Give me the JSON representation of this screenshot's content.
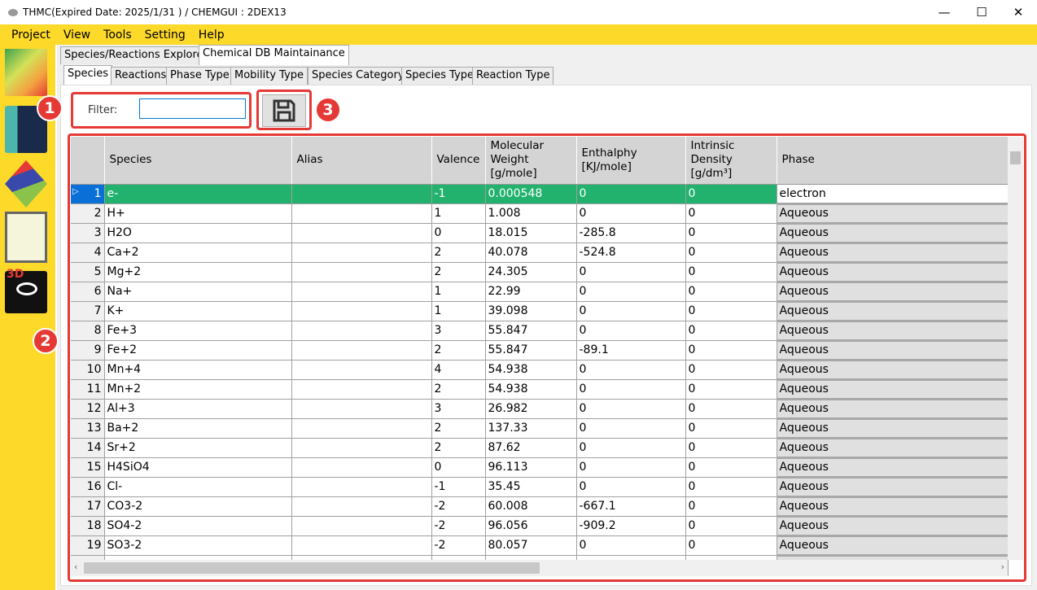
{
  "window": {
    "title": "THMC(Expired Date: 2025/1/31 ) / CHEMGUI : 2DEX13",
    "minimize": "—",
    "maximize": "☐",
    "close": "✕"
  },
  "menu": [
    "Project",
    "View",
    "Tools",
    "Setting",
    "Help"
  ],
  "sidebar": {
    "icons": [
      "map-contour-icon",
      "chemistry-books-icon",
      "3d-layers-icon",
      "thmc-sliders-icon",
      "3d-viewer-eye-icon"
    ],
    "viewer_label": "3D"
  },
  "outer_tabs": [
    {
      "label": "Species/Reactions Explorer",
      "active": false
    },
    {
      "label": "Chemical DB Maintainance",
      "active": true
    }
  ],
  "inner_tabs": [
    {
      "label": "Species",
      "active": true
    },
    {
      "label": "Reactions"
    },
    {
      "label": "Phase Type"
    },
    {
      "label": "Mobility Type"
    },
    {
      "label": "Species Category"
    },
    {
      "label": "Species Type"
    },
    {
      "label": "Reaction Type"
    }
  ],
  "filter": {
    "label": "Filter:",
    "value": ""
  },
  "annotations": [
    "1",
    "2",
    "3"
  ],
  "accent": "#e53935",
  "selected_row_color": "#22b26e",
  "table": {
    "columns": [
      "Species",
      "Alias",
      "Valence",
      "Molecular Weight [g/mole]",
      "Enthalphy [KJ/mole]",
      "Intrinsic Density [g/dm³]",
      "Phase"
    ],
    "rows": [
      [
        "1",
        "e-",
        "",
        "-1",
        "0.000548",
        "0",
        "0",
        "electron"
      ],
      [
        "2",
        "H+",
        "",
        "1",
        "1.008",
        "0",
        "0",
        "Aqueous"
      ],
      [
        "3",
        "H2O",
        "",
        "0",
        "18.015",
        "-285.8",
        "0",
        "Aqueous"
      ],
      [
        "4",
        "Ca+2",
        "",
        "2",
        "40.078",
        "-524.8",
        "0",
        "Aqueous"
      ],
      [
        "5",
        "Mg+2",
        "",
        "2",
        "24.305",
        "0",
        "0",
        "Aqueous"
      ],
      [
        "6",
        "Na+",
        "",
        "1",
        "22.99",
        "0",
        "0",
        "Aqueous"
      ],
      [
        "7",
        "K+",
        "",
        "1",
        "39.098",
        "0",
        "0",
        "Aqueous"
      ],
      [
        "8",
        "Fe+3",
        "",
        "3",
        "55.847",
        "0",
        "0",
        "Aqueous"
      ],
      [
        "9",
        "Fe+2",
        "",
        "2",
        "55.847",
        "-89.1",
        "0",
        "Aqueous"
      ],
      [
        "10",
        "Mn+4",
        "",
        "4",
        "54.938",
        "0",
        "0",
        "Aqueous"
      ],
      [
        "11",
        "Mn+2",
        "",
        "2",
        "54.938",
        "0",
        "0",
        "Aqueous"
      ],
      [
        "12",
        "Al+3",
        "",
        "3",
        "26.982",
        "0",
        "0",
        "Aqueous"
      ],
      [
        "13",
        "Ba+2",
        "",
        "2",
        "137.33",
        "0",
        "0",
        "Aqueous"
      ],
      [
        "14",
        "Sr+2",
        "",
        "2",
        "87.62",
        "0",
        "0",
        "Aqueous"
      ],
      [
        "15",
        "H4SiO4",
        "",
        "0",
        "96.113",
        "0",
        "0",
        "Aqueous"
      ],
      [
        "16",
        "Cl-",
        "",
        "-1",
        "35.45",
        "0",
        "0",
        "Aqueous"
      ],
      [
        "17",
        "CO3-2",
        "",
        "-2",
        "60.008",
        "-667.1",
        "0",
        "Aqueous"
      ],
      [
        "18",
        "SO4-2",
        "",
        "-2",
        "96.056",
        "-909.2",
        "0",
        "Aqueous"
      ],
      [
        "19",
        "SO3-2",
        "",
        "-2",
        "80.057",
        "0",
        "0",
        "Aqueous"
      ]
    ]
  }
}
